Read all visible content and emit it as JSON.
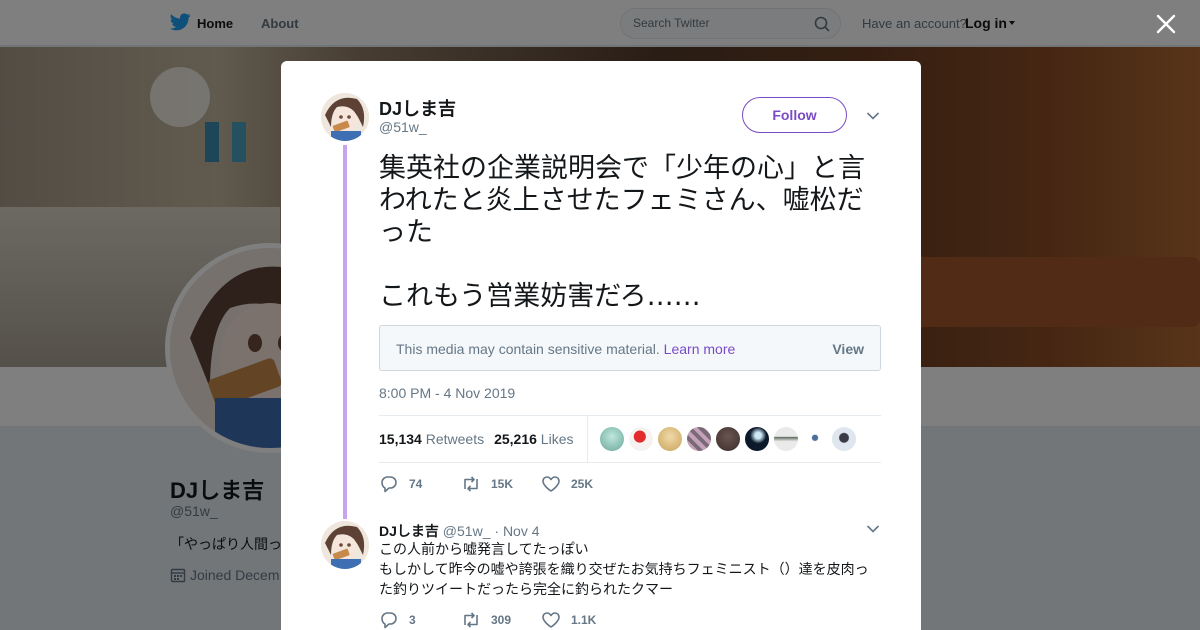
{
  "nav": {
    "home": "Home",
    "about": "About",
    "search_placeholder": "Search Twitter",
    "account_prompt": "Have an account?",
    "login": "Log in"
  },
  "profile": {
    "name": "DJしま吉",
    "handle": "@51w_",
    "bio": "「やっぱり人間っ",
    "joined": "Joined Decem"
  },
  "tweet": {
    "author_name": "DJしま吉",
    "author_handle": "@51w_",
    "follow_label": "Follow",
    "text": "集英社の企業説明会で「少年の心」と言われたと炎上させたフェミさん、嘘松だった\n\nこれもう営業妨害だろ……",
    "sensitive_text": "This media may contain sensitive material.",
    "sensitive_link": "Learn more",
    "sensitive_view": "View",
    "timestamp": "8:00 PM - 4 Nov 2019",
    "retweets_count": "15,134",
    "retweets_label": "Retweets",
    "likes_count": "25,216",
    "likes_label": "Likes",
    "actions": {
      "replies": "74",
      "retweets": "15K",
      "likes": "25K"
    }
  },
  "reply": {
    "author_name": "DJしま吉",
    "author_handle": "@51w_",
    "separator": "·",
    "date": "Nov 4",
    "text": "この人前から嘘発言してたっぽい\nもしかして昨今の嘘や誇張を織り交ぜたお気持ちフェミニスト（）達を皮肉った釣りツイートだったら完全に釣られたクマー",
    "actions": {
      "replies": "3",
      "retweets": "309",
      "likes": "1.1K"
    }
  },
  "colors": {
    "accent": "#794bc4",
    "thread": "#c9a3ef",
    "twitter_blue": "#1da1f2",
    "muted": "#657786"
  },
  "icons": [
    "twitter-bird-icon",
    "search-icon",
    "caret-down-icon",
    "close-icon",
    "chevron-down-icon",
    "reply-icon",
    "retweet-icon",
    "heart-icon",
    "calendar-icon"
  ]
}
